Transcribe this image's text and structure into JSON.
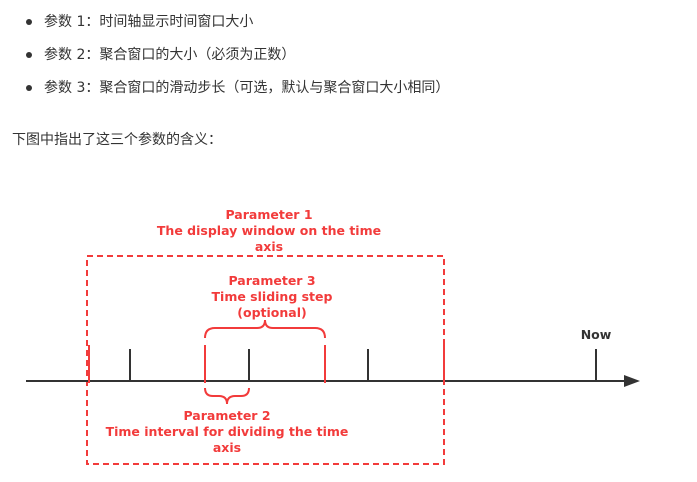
{
  "bullets": [
    {
      "label": "参数 1：时间轴显示时间窗口大小"
    },
    {
      "label": "参数 2：聚合窗口的大小（必须为正数）"
    },
    {
      "label": "参数 3：聚合窗口的滑动步长（可选，默认与聚合窗口大小相同）"
    }
  ],
  "intro": "下图中指出了这三个参数的含义：",
  "diagram": {
    "param1": {
      "line1": "Parameter 1",
      "line2": "The display window on the time",
      "line3": "axis"
    },
    "param3": {
      "line1": "Parameter 3",
      "line2": "Time sliding step",
      "line3": "(optional)"
    },
    "param2": {
      "line1": "Parameter 2",
      "line2": "Time interval for dividing the time",
      "line3": "axis"
    },
    "now_label": "Now",
    "accent_color": "#f23b3b",
    "axis_color": "#333333"
  }
}
